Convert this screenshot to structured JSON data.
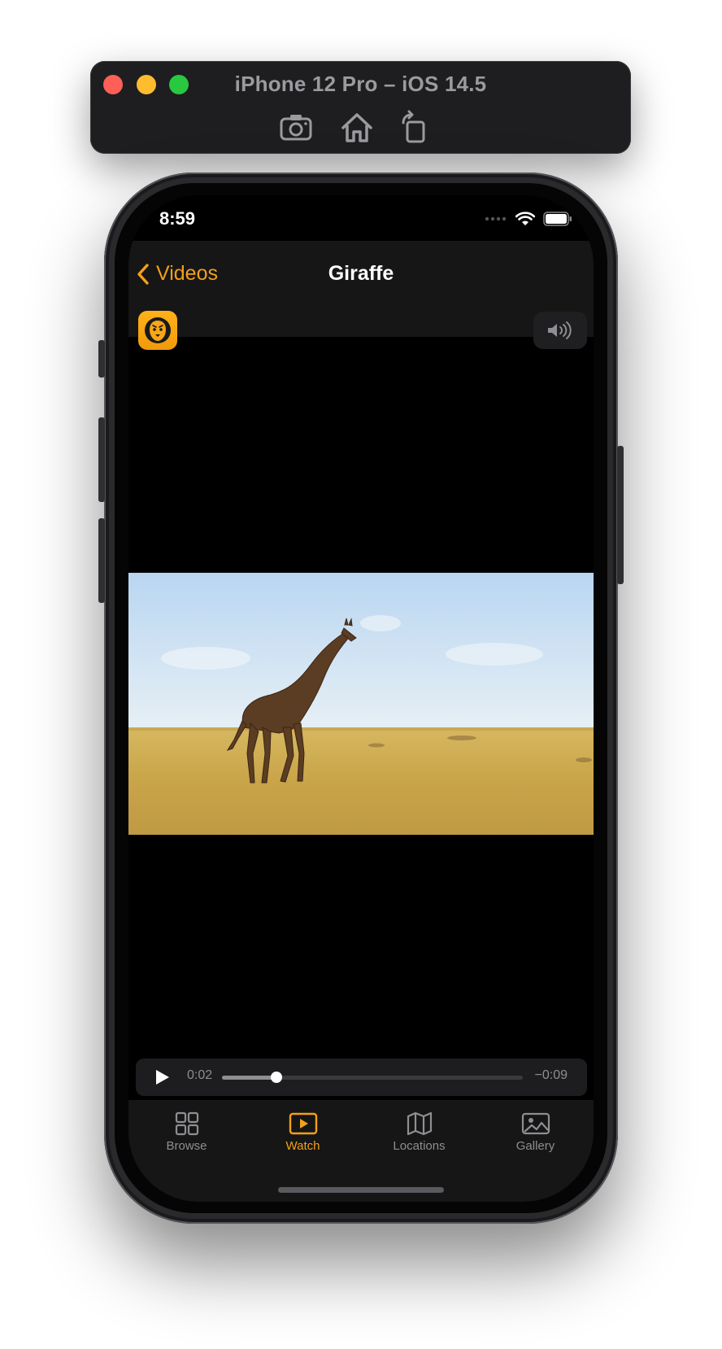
{
  "simulator": {
    "title": "iPhone 12 Pro – iOS 14.5",
    "toolbar": [
      "screenshot-icon",
      "home-icon",
      "rotate-icon"
    ]
  },
  "status_bar": {
    "time": "8:59"
  },
  "nav": {
    "back_label": "Videos",
    "title": "Giraffe"
  },
  "player": {
    "elapsed": "0:02",
    "remaining": "−0:09",
    "progress": 0.18
  },
  "tabs": [
    {
      "label": "Browse",
      "icon": "grid-icon",
      "active": false
    },
    {
      "label": "Watch",
      "icon": "play-rect-icon",
      "active": true
    },
    {
      "label": "Locations",
      "icon": "map-icon",
      "active": false
    },
    {
      "label": "Gallery",
      "icon": "photo-icon",
      "active": false
    }
  ],
  "colors": {
    "accent": "#f3a019",
    "background": "#000000",
    "bar": "#161616"
  }
}
